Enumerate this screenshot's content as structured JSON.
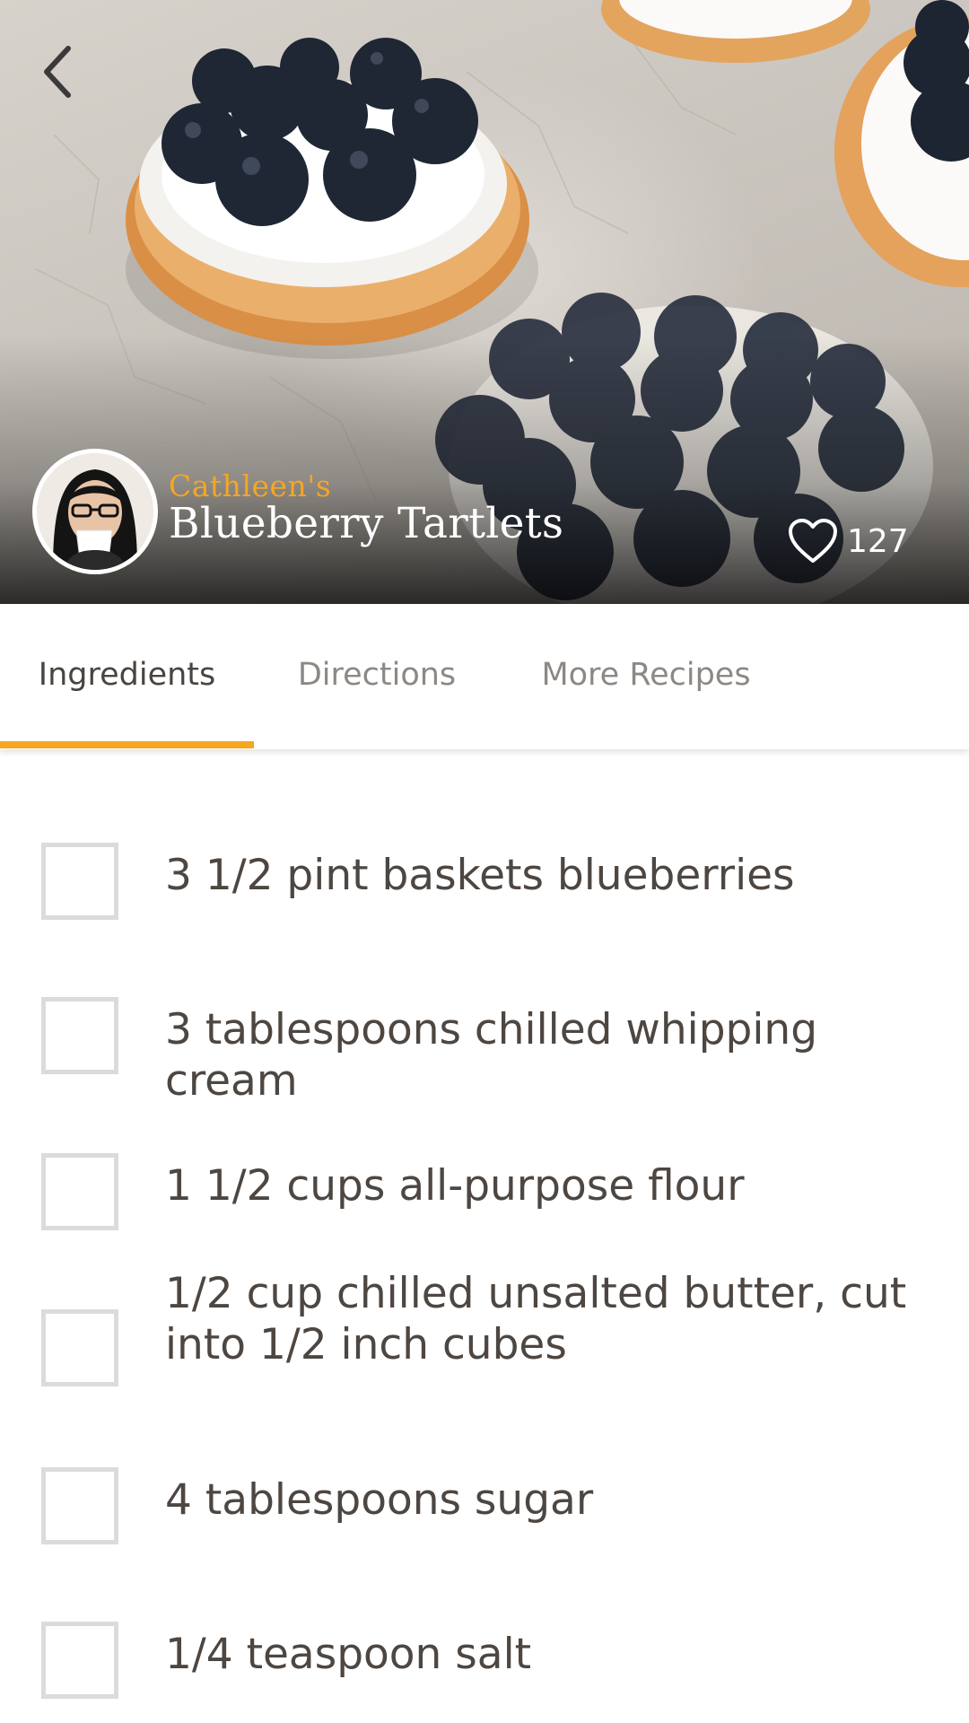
{
  "header": {
    "back_icon": "chevron-left-icon",
    "author_possessive": "Cathleen's",
    "recipe_title": "Blueberry Tartlets",
    "like_icon": "heart-outline-icon",
    "like_count": "127"
  },
  "tabs": [
    {
      "label": "Ingredients",
      "active": true
    },
    {
      "label": "Directions",
      "active": false
    },
    {
      "label": "More Recipes",
      "active": false
    }
  ],
  "ingredients": [
    {
      "text": "3 1/2 pint baskets blueberries",
      "checked": false
    },
    {
      "text": "3 tablespoons chilled whipping cream",
      "checked": false
    },
    {
      "text": "1 1/2 cups all-purpose flour",
      "checked": false
    },
    {
      "text": "1/2 cup chilled unsalted butter, cut into 1/2 inch cubes",
      "checked": false
    },
    {
      "text": "4 tablespoons sugar",
      "checked": false
    },
    {
      "text": "1/4 teaspoon salt",
      "checked": false
    }
  ],
  "colors": {
    "accent": "#f5a623",
    "text": "#4a4440",
    "muted_tab": "#8d8884",
    "checkbox_border": "#dcdadd"
  }
}
